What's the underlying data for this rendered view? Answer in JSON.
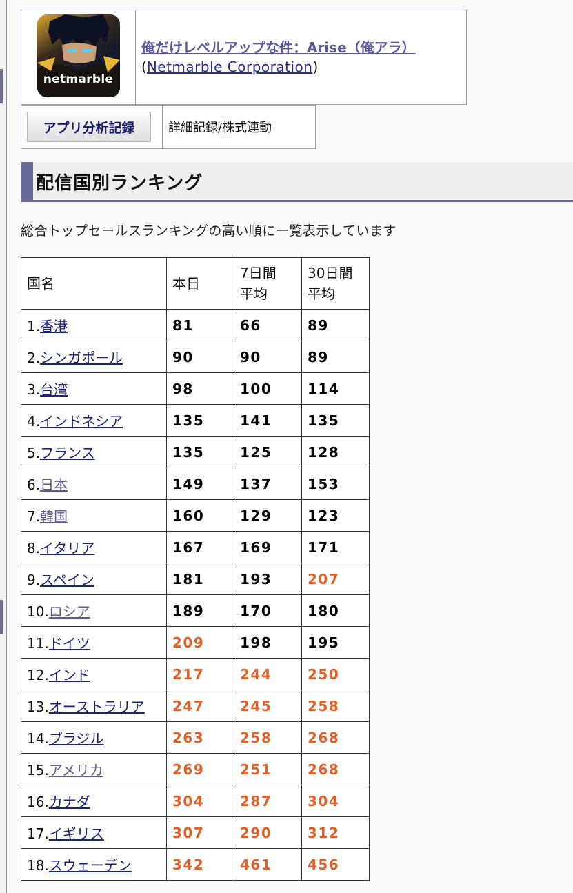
{
  "app": {
    "icon_brand": "netmarble",
    "title": "俺だけレベルアップな件：Arise（俺アラ）",
    "publisher_prefix": "(",
    "publisher": "Netmarble Corporation",
    "publisher_suffix": ")"
  },
  "records": {
    "button_label": "アプリ分析記録",
    "detail_label": "詳細記録/株式連動"
  },
  "section": {
    "title": "配信国別ランキング",
    "description": "総合トップセールスランキングの高い順に一覧表示しています"
  },
  "table": {
    "headers": {
      "country": "国名",
      "today": "本日",
      "avg7_line1": "7日間",
      "avg7_line2": "平均",
      "avg30_line1": "30日間",
      "avg30_line2": "平均"
    },
    "highlight_color": "#e0602a",
    "rows": [
      {
        "rank": "1.",
        "country": "香港",
        "today": "81",
        "avg7": "66",
        "avg30": "89"
      },
      {
        "rank": "2.",
        "country": "シンガポール",
        "today": "90",
        "avg7": "90",
        "avg30": "89"
      },
      {
        "rank": "3.",
        "country": "台湾",
        "today": "98",
        "avg7": "100",
        "avg30": "114"
      },
      {
        "rank": "4.",
        "country": "インドネシア",
        "today": "135",
        "avg7": "141",
        "avg30": "135"
      },
      {
        "rank": "5.",
        "country": "フランス",
        "today": "135",
        "avg7": "125",
        "avg30": "128"
      },
      {
        "rank": "6.",
        "country": "日本",
        "today": "149",
        "avg7": "137",
        "avg30": "153"
      },
      {
        "rank": "7.",
        "country": "韓国",
        "today": "160",
        "avg7": "129",
        "avg30": "123"
      },
      {
        "rank": "8.",
        "country": "イタリア",
        "today": "167",
        "avg7": "169",
        "avg30": "171"
      },
      {
        "rank": "9.",
        "country": "スペイン",
        "today": "181",
        "avg7": "193",
        "avg30": "207"
      },
      {
        "rank": "10.",
        "country": "ロシア",
        "today": "189",
        "avg7": "170",
        "avg30": "180"
      },
      {
        "rank": "11.",
        "country": "ドイツ",
        "today": "209",
        "avg7": "198",
        "avg30": "195"
      },
      {
        "rank": "12.",
        "country": "インド",
        "today": "217",
        "avg7": "244",
        "avg30": "250"
      },
      {
        "rank": "13.",
        "country": "オーストラリア",
        "today": "247",
        "avg7": "245",
        "avg30": "258"
      },
      {
        "rank": "14.",
        "country": "ブラジル",
        "today": "263",
        "avg7": "258",
        "avg30": "268"
      },
      {
        "rank": "15.",
        "country": "アメリカ",
        "today": "269",
        "avg7": "251",
        "avg30": "268"
      },
      {
        "rank": "16.",
        "country": "カナダ",
        "today": "304",
        "avg7": "287",
        "avg30": "304"
      },
      {
        "rank": "17.",
        "country": "イギリス",
        "today": "307",
        "avg7": "290",
        "avg30": "312"
      },
      {
        "rank": "18.",
        "country": "スウェーデン",
        "today": "342",
        "avg7": "461",
        "avg30": "456"
      }
    ]
  }
}
